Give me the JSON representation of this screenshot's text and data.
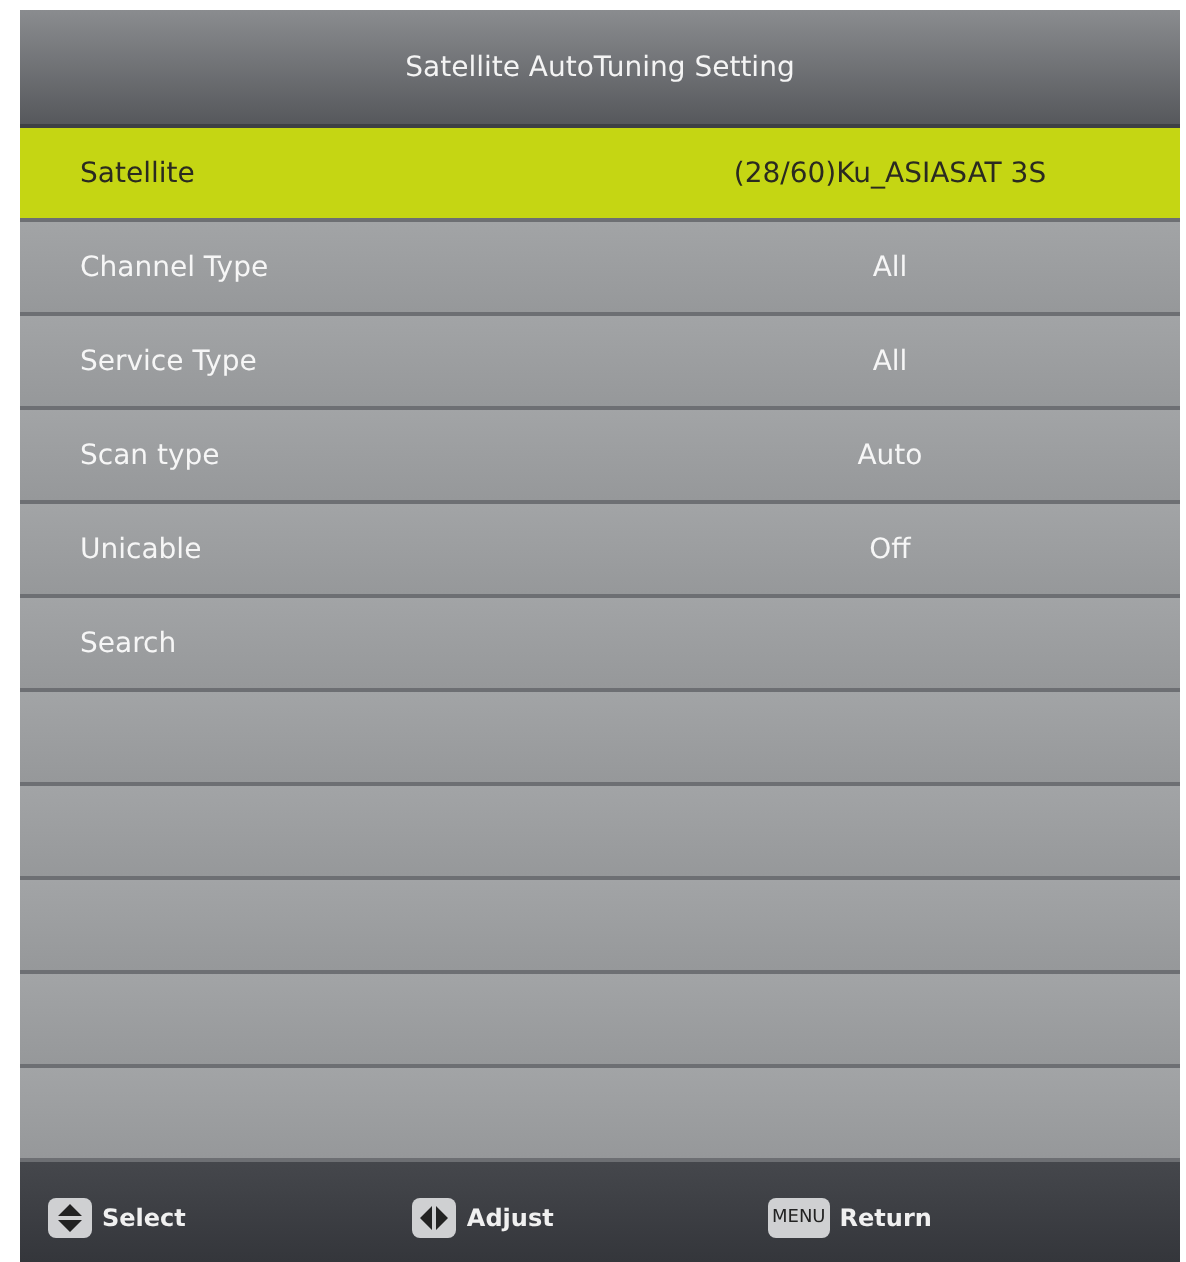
{
  "title": "Satellite AutoTuning Setting",
  "items": [
    {
      "label": "Satellite",
      "value": "(28/60)Ku_ASIASAT 3S",
      "selected": true
    },
    {
      "label": "Channel Type",
      "value": "All",
      "selected": false
    },
    {
      "label": "Service Type",
      "value": "All",
      "selected": false
    },
    {
      "label": "Scan type",
      "value": "Auto",
      "selected": false
    },
    {
      "label": "Unicable",
      "value": "Off",
      "selected": false
    },
    {
      "label": "Search",
      "selected": false
    }
  ],
  "hints": [
    {
      "kind": "updown",
      "label": "Select"
    },
    {
      "kind": "leftright",
      "label": "Adjust"
    },
    {
      "kind": "key",
      "key": "MENU",
      "label": "Return"
    }
  ]
}
